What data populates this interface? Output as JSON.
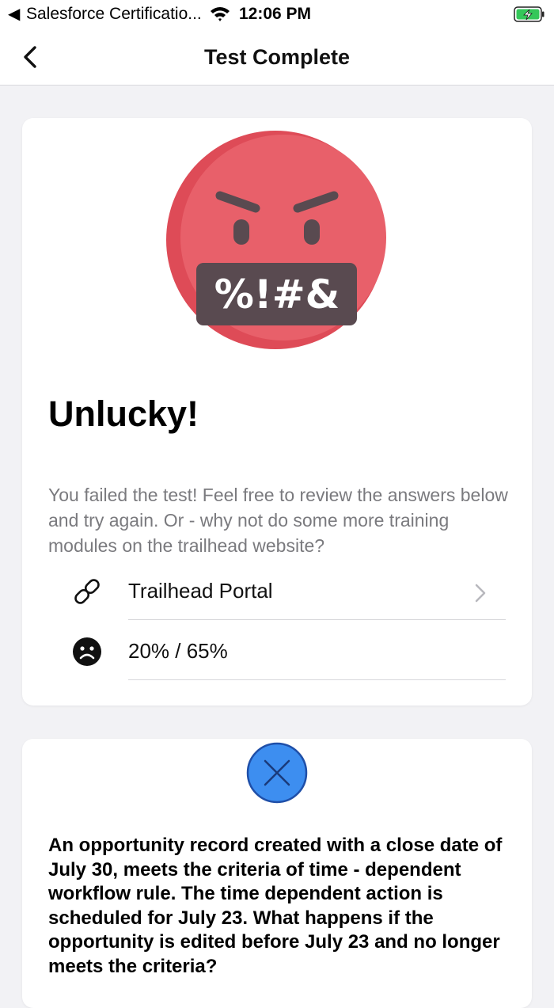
{
  "status_bar": {
    "back_indicator": "◀",
    "app_name": "Salesforce Certificatio...",
    "time": "12:06 PM",
    "wifi_icon": "wifi-icon",
    "battery_icon": "battery-charging-icon"
  },
  "nav": {
    "title": "Test Complete",
    "back_icon": "chevron-left-icon"
  },
  "result": {
    "face_icon": "angry-face-icon",
    "face_symbols": "%!#&",
    "title": "Unlucky!",
    "message": "You failed the test! Feel free to review the answers below and try again. Or - why not do some more training modules on the trailhead website?",
    "links": [
      {
        "icon": "link-icon",
        "label": "Trailhead Portal",
        "chevron": "chevron-right-icon"
      },
      {
        "icon": "sad-face-icon",
        "label": "20% / 65%"
      }
    ]
  },
  "question": {
    "status_icon": "incorrect-x-icon",
    "text": "An opportunity record created with a close date of July 30, meets the criteria of time - dependent workflow rule. The time dependent action is scheduled for July 23. What happens if the opportunity is edited before July 23 and no longer meets the criteria?"
  },
  "colors": {
    "face_red": "#e8606a",
    "face_shadow": "#de4b57",
    "mouth_dark": "#594a50",
    "badge_blue": "#3d8ef0",
    "battery_green": "#34c759",
    "muted_text": "#7a7a7e",
    "divider": "#d8d8dc"
  }
}
